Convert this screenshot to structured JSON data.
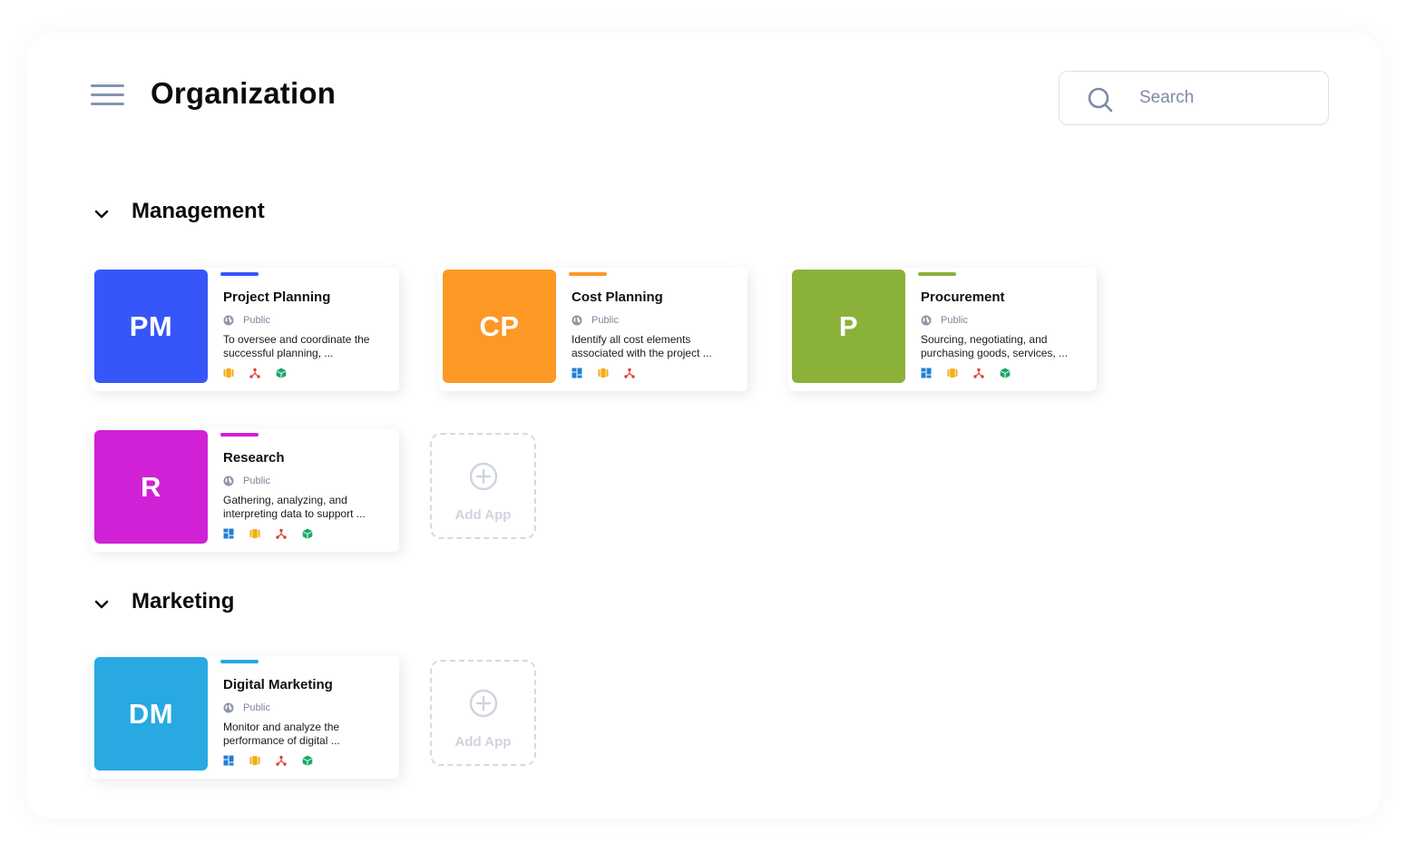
{
  "header": {
    "title": "Organization",
    "menu_icon": "hamburger-menu-icon",
    "search": {
      "placeholder": "Search",
      "value": "",
      "icon": "search-icon"
    }
  },
  "colors": {
    "blue": "#3656f9",
    "orange": "#fd9825",
    "green": "#8bb238",
    "magenta": "#d021d7",
    "sky": "#28a9e1",
    "icon_grid": "#1f7fd4",
    "icon_film": "#f3ad17",
    "icon_nodes": "#e23b35",
    "icon_box": "#1ea66b"
  },
  "sections": [
    {
      "label": "Management",
      "icon": "chevron-down-icon",
      "apps": [
        {
          "initials": "PM",
          "name": "Project Planning",
          "visibility": "Public",
          "desc1": "To oversee and coordinate the",
          "desc2": "successful planning, ...",
          "icons": [
            "film-icon",
            "nodes-icon",
            "box-icon"
          ]
        },
        {
          "initials": "CP",
          "name": "Cost Planning",
          "visibility": "Public",
          "desc1": "Identify all cost elements",
          "desc2": "associated with the project ...",
          "icons": [
            "grid-icon",
            "film-icon",
            "nodes-icon"
          ]
        },
        {
          "initials": "P",
          "name": "Procurement",
          "visibility": "Public",
          "desc1": "Sourcing, negotiating, and",
          "desc2": "purchasing goods, services, ...",
          "icons": [
            "grid-icon",
            "film-icon",
            "nodes-icon",
            "box-icon"
          ]
        },
        {
          "initials": "R",
          "name": "Research",
          "visibility": "Public",
          "desc1": "Gathering, analyzing, and",
          "desc2": "interpreting data to support ...",
          "icons": [
            "grid-icon",
            "film-icon",
            "nodes-icon",
            "box-icon"
          ]
        }
      ],
      "add_label": "Add App"
    },
    {
      "label": "Marketing",
      "icon": "chevron-down-icon",
      "apps": [
        {
          "initials": "DM",
          "name": "Digital Marketing",
          "visibility": "Public",
          "desc1": "Monitor and analyze the",
          "desc2": "performance of digital ...",
          "icons": [
            "grid-icon",
            "film-icon",
            "nodes-icon",
            "box-icon"
          ]
        }
      ],
      "add_label": "Add App"
    }
  ]
}
